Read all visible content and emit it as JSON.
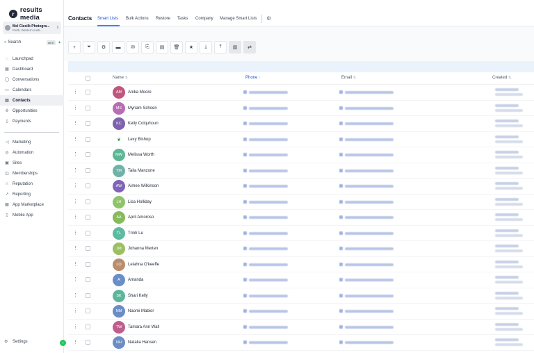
{
  "brand": {
    "name": "results media",
    "mark": "r"
  },
  "account": {
    "name": "Mel Ciesilk Photogra...",
    "location": "Perth, Western Austr..."
  },
  "search": {
    "label": "Search",
    "shortcut": "ctrl K"
  },
  "nav_primary": [
    {
      "label": "Launchpad",
      "icon": "launchpad-icon",
      "glyph": "◌"
    },
    {
      "label": "Dashboard",
      "icon": "dashboard-icon",
      "glyph": "▦"
    },
    {
      "label": "Conversations",
      "icon": "chat-icon",
      "glyph": "◯"
    },
    {
      "label": "Calendars",
      "icon": "calendar-icon",
      "glyph": "▭"
    },
    {
      "label": "Contacts",
      "icon": "contacts-icon",
      "glyph": "▤",
      "active": true
    },
    {
      "label": "Opportunities",
      "icon": "opportunities-icon",
      "glyph": "✣"
    },
    {
      "label": "Payments",
      "icon": "payments-icon",
      "glyph": "▯"
    }
  ],
  "nav_secondary": [
    {
      "label": "Marketing",
      "icon": "marketing-icon",
      "glyph": "◁"
    },
    {
      "label": "Automation",
      "icon": "automation-icon",
      "glyph": "◎"
    },
    {
      "label": "Sites",
      "icon": "sites-icon",
      "glyph": "▣"
    },
    {
      "label": "Memberships",
      "icon": "memberships-icon",
      "glyph": "◫"
    },
    {
      "label": "Reputation",
      "icon": "star-icon",
      "glyph": "☆"
    },
    {
      "label": "Reporting",
      "icon": "reporting-icon",
      "glyph": "↗"
    },
    {
      "label": "App Marketplace",
      "icon": "marketplace-icon",
      "glyph": "▦"
    },
    {
      "label": "Mobile App",
      "icon": "mobile-icon",
      "glyph": "▯"
    }
  ],
  "settings": {
    "label": "Settings"
  },
  "page": {
    "title": "Contacts"
  },
  "tabs": [
    "Smart Lists",
    "Bulk Actions",
    "Restore",
    "Tasks",
    "Company",
    "Manage Smart Lists"
  ],
  "toolbar": [
    {
      "name": "add-contact-button",
      "glyph": "+"
    },
    {
      "name": "filter-button",
      "glyph": "⏷"
    },
    {
      "name": "automation-button",
      "glyph": "⚙"
    },
    {
      "name": "sms-button",
      "glyph": "▬"
    },
    {
      "name": "email-button",
      "glyph": "✉"
    },
    {
      "name": "copy-button",
      "glyph": "⎘"
    },
    {
      "name": "paste-button",
      "glyph": "▤"
    },
    {
      "name": "delete-button",
      "glyph": "🗑"
    },
    {
      "name": "star-button",
      "glyph": "★"
    },
    {
      "name": "download-button",
      "glyph": "⤓"
    },
    {
      "name": "upload-button",
      "glyph": "⤒"
    },
    {
      "name": "stats-button",
      "glyph": "▥"
    },
    {
      "name": "merge-button",
      "glyph": "⇄"
    }
  ],
  "table": {
    "columns": {
      "name": "Name",
      "phone": "Phone",
      "email": "Email",
      "created": "Created"
    },
    "rows": [
      {
        "initials": "AM",
        "name": "Anika Moore",
        "color": "#c0567e"
      },
      {
        "initials": "MS",
        "name": "Myriam Schoen",
        "color": "#b96cb4"
      },
      {
        "initials": "KC",
        "name": "Kelly Colquhoun",
        "color": "#7e62ad"
      },
      {
        "initials": "",
        "name": "Lexy Bishop",
        "color": "#ffffff",
        "logo": true
      },
      {
        "initials": "MW",
        "name": "Melissa Worth",
        "color": "#5cb795"
      },
      {
        "initials": "TM",
        "name": "Taila Manzone",
        "color": "#6fb3a7"
      },
      {
        "initials": "AW",
        "name": "Aimee Wilkinson",
        "color": "#7f65b8"
      },
      {
        "initials": "LH",
        "name": "Lisa Holliday",
        "color": "#8fc46b"
      },
      {
        "initials": "AA",
        "name": "April Amoroso",
        "color": "#86ba5d"
      },
      {
        "initials": "TL",
        "name": "Trinh Le",
        "color": "#5dbba0"
      },
      {
        "initials": "JM",
        "name": "Johanna Merten",
        "color": "#9cbf63"
      },
      {
        "initials": "LO",
        "name": "Leiahna O'keeffe",
        "color": "#ba8d6c"
      },
      {
        "initials": "A",
        "name": "Amanda",
        "color": "#6b8ec9"
      },
      {
        "initials": "SK",
        "name": "Shari Kelly",
        "color": "#5db69a"
      },
      {
        "initials": "NM",
        "name": "Naomi Mabior",
        "color": "#6a8dc7"
      },
      {
        "initials": "TW",
        "name": "Tamara Ann Wall",
        "color": "#c05d8e"
      },
      {
        "initials": "NH",
        "name": "Natalia Hansen",
        "color": "#6b8ec4"
      }
    ]
  }
}
